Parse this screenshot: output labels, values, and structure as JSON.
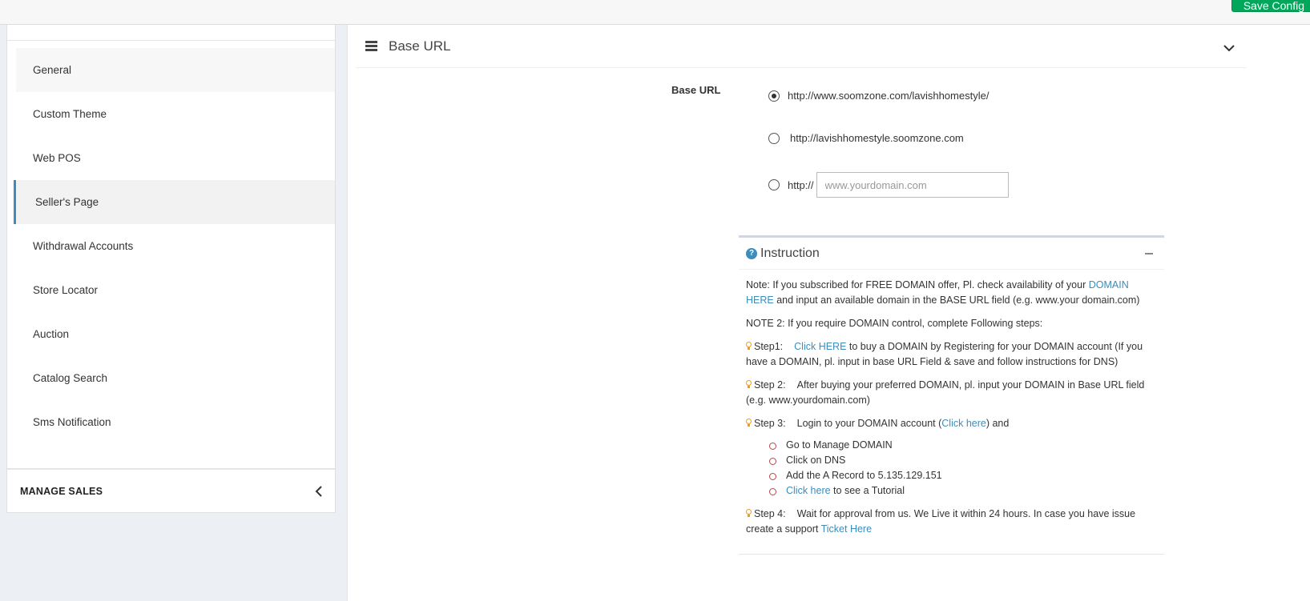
{
  "toolbar": {
    "save_label": "Save Config"
  },
  "sidebar": {
    "items": [
      {
        "label": "General"
      },
      {
        "label": "Custom Theme"
      },
      {
        "label": "Web POS"
      },
      {
        "label": "Seller's Page"
      },
      {
        "label": "Withdrawal Accounts"
      },
      {
        "label": "Store Locator"
      },
      {
        "label": "Auction"
      },
      {
        "label": "Catalog Search"
      },
      {
        "label": "Sms Notification"
      }
    ],
    "active_item": "Seller's Page",
    "section_label": "MANAGE SALES"
  },
  "panel": {
    "title": "Base URL",
    "field_label": "Base URL",
    "options": [
      {
        "label": "http://www.soomzone.com/lavishhomestyle/",
        "checked": true
      },
      {
        "label": "http://lavishhomestyle.soomzone.com",
        "checked": false
      },
      {
        "label": "http://",
        "checked": false,
        "input_value": "",
        "input_placeholder": "www.yourdomain.com"
      }
    ]
  },
  "instruction": {
    "title": "Instruction",
    "note1_pre": "Note: If you subscribed for FREE DOMAIN offer, Pl. check availability of your ",
    "note1_link": "DOMAIN HERE",
    "note1_post": " and input an available domain in the BASE URL field (e.g. www.your domain.com)",
    "note2": "NOTE 2: If you require DOMAIN control, complete Following steps:",
    "step1_label": "Step1:",
    "step1_link": "Click HERE",
    "step1_text": " to buy a DOMAIN by Registering for your DOMAIN account (If you have a DOMAIN, pl. input in base URL Field & save and follow instructions for DNS)",
    "step2_label": "Step 2:",
    "step2_text": "After buying your preferred DOMAIN, pl. input your DOMAIN in Base URL field (e.g. www.yourdomain.com)",
    "step3_label": "Step 3:",
    "step3_pre": "Login to your DOMAIN account (",
    "step3_link": "Click here",
    "step3_post": ") and",
    "substeps": [
      {
        "text": "Go to Manage DOMAIN"
      },
      {
        "text": "Click on DNS"
      },
      {
        "text": "Add the A Record to 5.135.129.151"
      },
      {
        "link": "Click here",
        "text": " to see a Tutorial"
      }
    ],
    "step4_label": "Step 4:",
    "step4_text": "Wait for approval from us. We Live it within 24 hours. In case you have issue create a support ",
    "step4_link": "Ticket Here"
  }
}
